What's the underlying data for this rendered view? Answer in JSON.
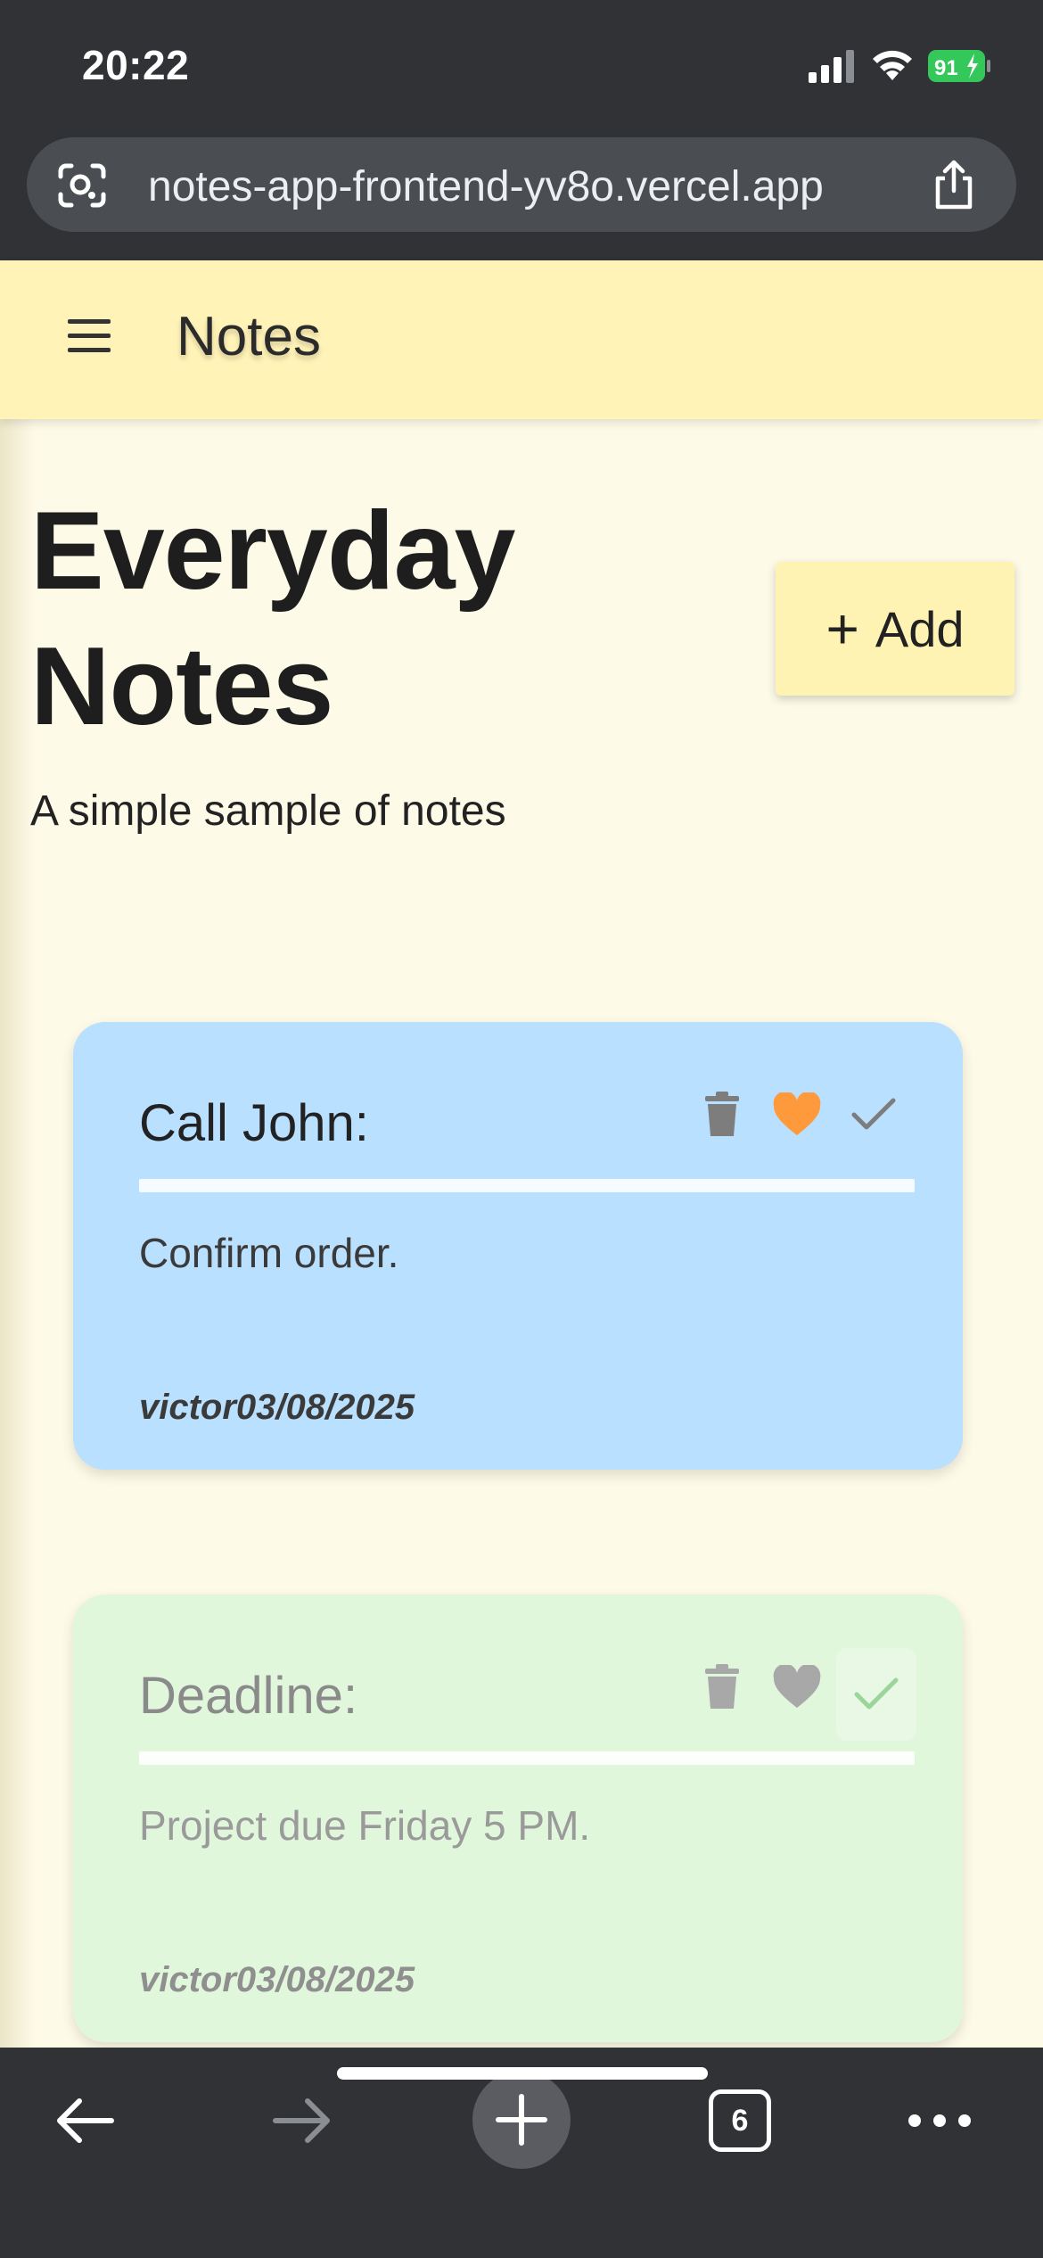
{
  "status": {
    "time": "20:22",
    "battery": "91"
  },
  "browser": {
    "url": "notes-app-frontend-yv8o.vercel.app",
    "tab_count": "6"
  },
  "app": {
    "title": "Notes",
    "page_title_line1": "Everyday",
    "page_title_line2": "Notes",
    "subtitle": "A simple sample of notes",
    "add_plus": "+",
    "add_label": "Add"
  },
  "notes": [
    {
      "title": "Call John:",
      "body": "Confirm order.",
      "meta": "victor03/08/2025",
      "favorite": true,
      "done": false,
      "color": "#b9e0ff"
    },
    {
      "title": "Deadline:",
      "body": "Project due Friday 5 PM.",
      "meta": "victor03/08/2025",
      "favorite": false,
      "done": true,
      "color": "#e1f7dc"
    }
  ],
  "colors": {
    "chrome": "#303236",
    "header": "#fff3b8",
    "background": "#fefae8",
    "favorite_active": "#ff9a3c",
    "done_active": "#9ad69a",
    "battery": "#34c759"
  },
  "icons": [
    "signal-icon",
    "wifi-icon",
    "battery-icon",
    "lens-icon",
    "share-icon",
    "menu-icon",
    "trash-icon",
    "heart-icon",
    "check-icon",
    "back-icon",
    "forward-icon",
    "plus-icon",
    "tabs-icon",
    "more-icon"
  ]
}
